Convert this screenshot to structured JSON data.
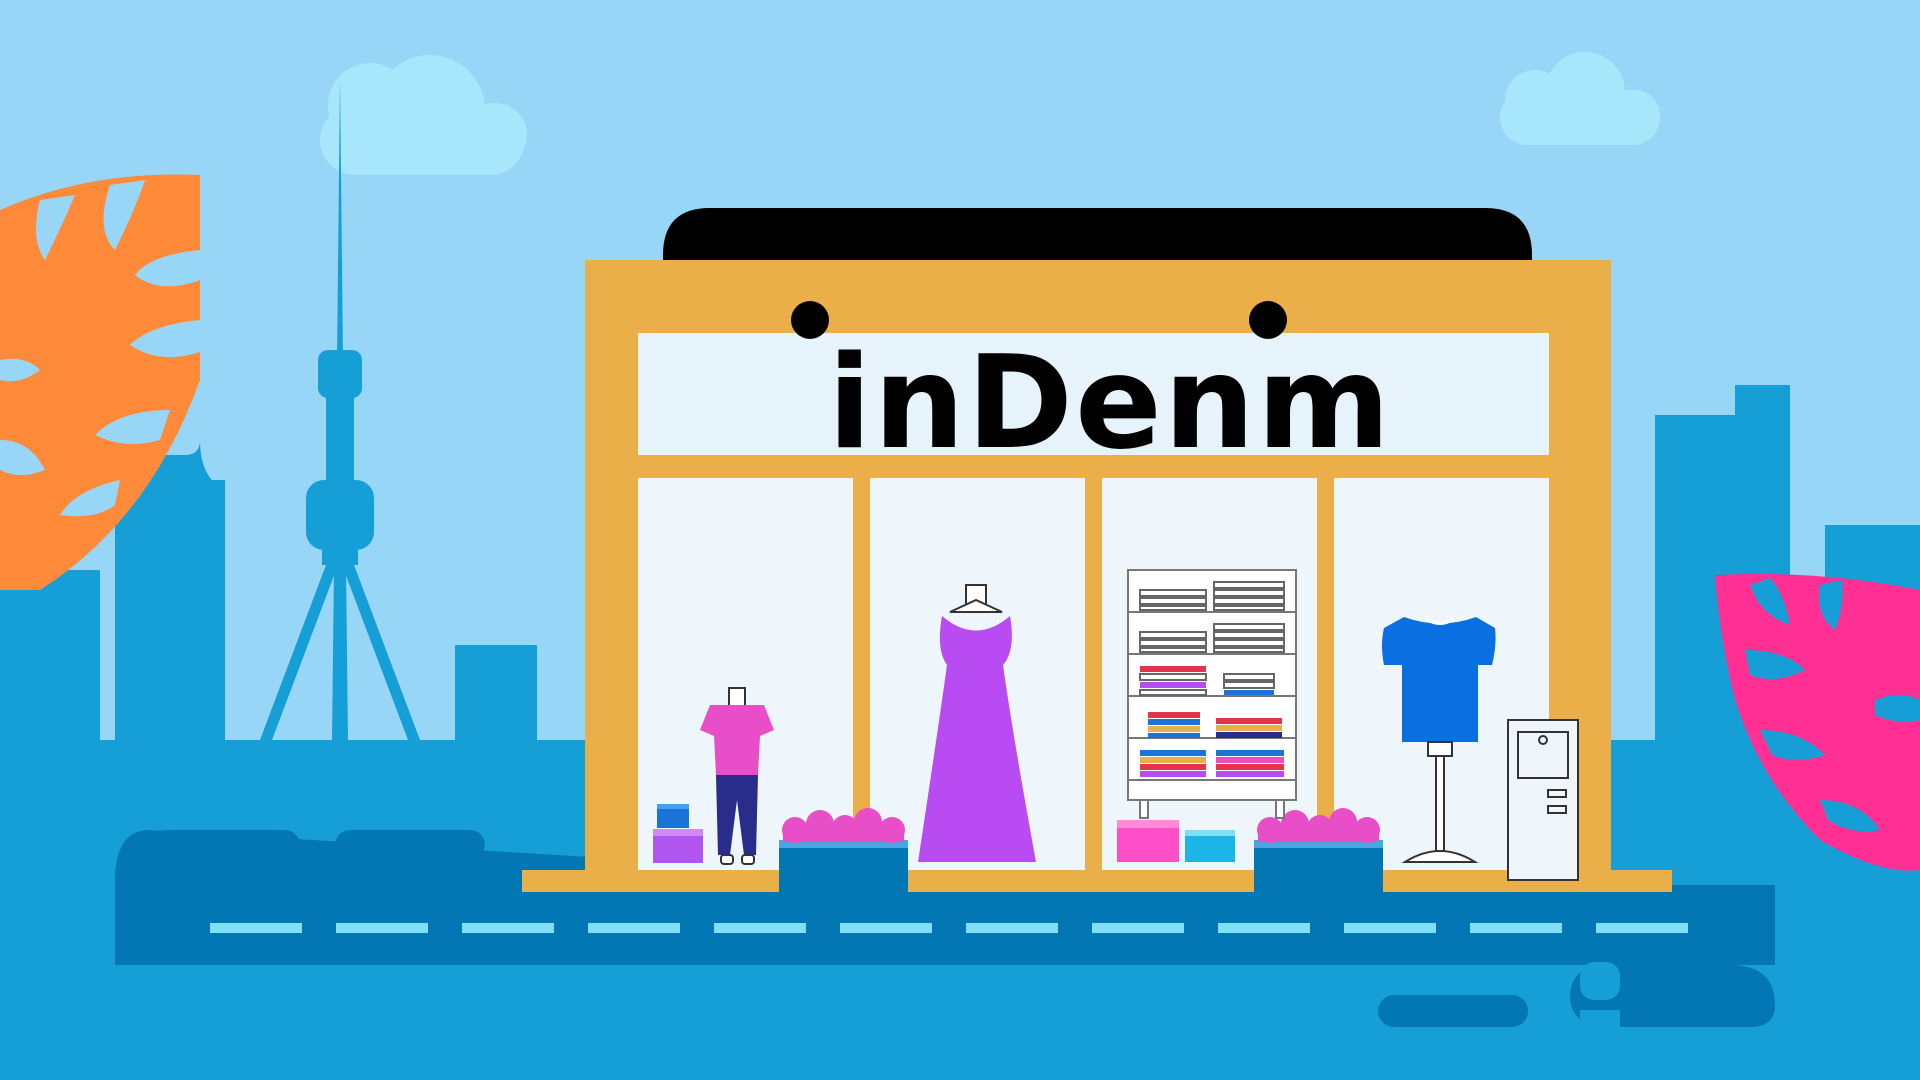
{
  "store": {
    "brand_name": "inDenm"
  },
  "colors": {
    "sky": "#97d6f6",
    "cloud": "#a8e6fb",
    "city": "#169fd7",
    "tower": "#169fd7",
    "road": "#0277b3",
    "road_dash": "#7fe0f5",
    "store_frame": "#ebaf49",
    "awning": "#000000",
    "sign_panel": "#e6f3fb",
    "window_glass": "#eef6fc",
    "leaf_left": "#ff8a3a",
    "leaf_right": "#ff2f94",
    "dress": "#b84bf2",
    "tshirt_blue": "#0a6fe0",
    "pink": "#e84ec8"
  },
  "icons": [
    "cn-tower-icon",
    "cloud-icon",
    "monstera-leaf-icon",
    "storefront-icon",
    "mannequin-icon",
    "dress-icon",
    "shelf-icon",
    "tshirt-icon",
    "door-icon"
  ]
}
